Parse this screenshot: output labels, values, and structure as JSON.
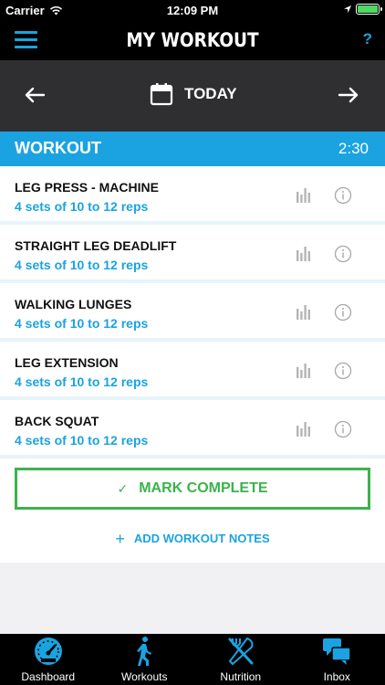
{
  "status_bar": {
    "carrier": "Carrier",
    "time": "12:09 PM",
    "battery_level": 1.0
  },
  "nav": {
    "title": "MY WORKOUT",
    "help_label": "?",
    "menu_icon": "hamburger-menu-icon"
  },
  "date_bar": {
    "date_label": "TODAY",
    "prev_icon": "arrow-left-icon",
    "next_icon": "arrow-right-icon",
    "calendar_icon": "calendar-icon"
  },
  "section": {
    "label": "WORKOUT",
    "duration": "2:30"
  },
  "exercises": [
    {
      "name": "LEG PRESS - MACHINE",
      "sets": "4 sets of 10 to 12 reps"
    },
    {
      "name": "STRAIGHT LEG DEADLIFT",
      "sets": "4 sets of 10 to 12 reps"
    },
    {
      "name": "WALKING LUNGES",
      "sets": "4 sets of 10 to 12 reps"
    },
    {
      "name": "LEG EXTENSION",
      "sets": "4 sets of 10 to 12 reps"
    },
    {
      "name": "BACK SQUAT",
      "sets": "4 sets of 10 to 12 reps"
    }
  ],
  "actions": {
    "mark_complete": "MARK COMPLETE",
    "check_glyph": "✓",
    "add_notes": "ADD WORKOUT NOTES",
    "plus_glyph": "+"
  },
  "tabs": [
    {
      "label": "Dashboard",
      "icon": "speedometer-icon"
    },
    {
      "label": "Workouts",
      "icon": "walking-person-icon"
    },
    {
      "label": "Nutrition",
      "icon": "fork-knife-icon"
    },
    {
      "label": "Inbox",
      "icon": "chat-bubbles-icon"
    }
  ],
  "colors": {
    "accent": "#1aa3e0",
    "success": "#3cb34a",
    "bar_bg": "#000000",
    "date_bg": "#2f2f31"
  }
}
